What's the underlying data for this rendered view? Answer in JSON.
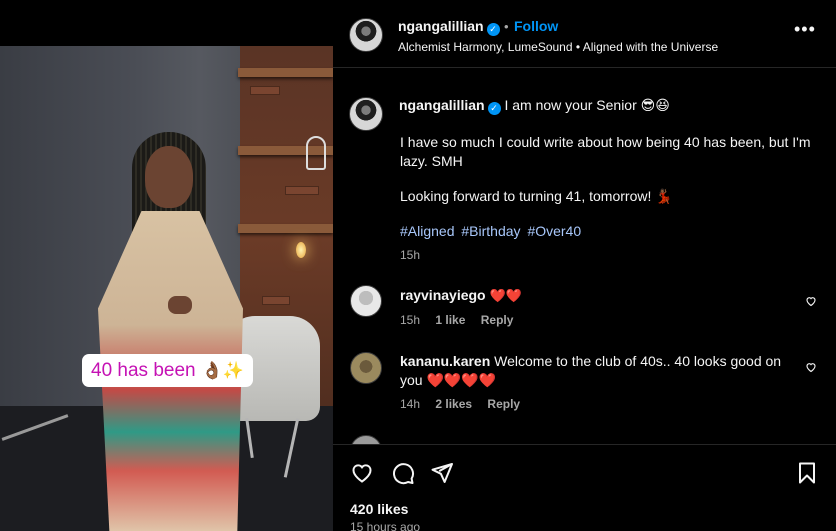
{
  "post": {
    "photo_sticker": "40 has been",
    "photo_sticker_emoji": "👌🏾✨"
  },
  "header": {
    "username": "ngangalillian",
    "verified_icon": "verified-badge-icon",
    "separator": "•",
    "follow_label": "Follow",
    "subtitle": "Alchemist Harmony, LumeSound • Aligned with the Universe",
    "more_label": "..."
  },
  "caption": {
    "username": "ngangalillian",
    "first_line": "I am now your Senior 😎😆",
    "paragraph1": "I have so much I could write about how being 40 has been, but I'm lazy. SMH",
    "paragraph2": "Looking forward to turning 41, tomorrow! 💃🏾",
    "hashtags": [
      "#Aligned",
      "#Birthday",
      "#Over40"
    ],
    "time": "15h"
  },
  "comments": [
    {
      "username": "rayvinayiego",
      "text": "❤️❤️",
      "time": "15h",
      "likes": "1 like",
      "reply_label": "Reply"
    },
    {
      "username": "kananu.karen",
      "text": "Welcome to the club of 40s.. 40 looks good on you ❤️❤️❤️❤️",
      "time": "14h",
      "likes": "2 likes",
      "reply_label": "Reply"
    },
    {
      "username": "",
      "text": "",
      "time": "",
      "likes": "",
      "reply_label": ""
    }
  ],
  "footer": {
    "likes": "420 likes",
    "posted": "15 hours ago"
  },
  "colors": {
    "accent": "#0095f6",
    "hashtag": "#a8c7fa",
    "sticker_text": "#c512b4",
    "heart": "#ed2a3b"
  }
}
